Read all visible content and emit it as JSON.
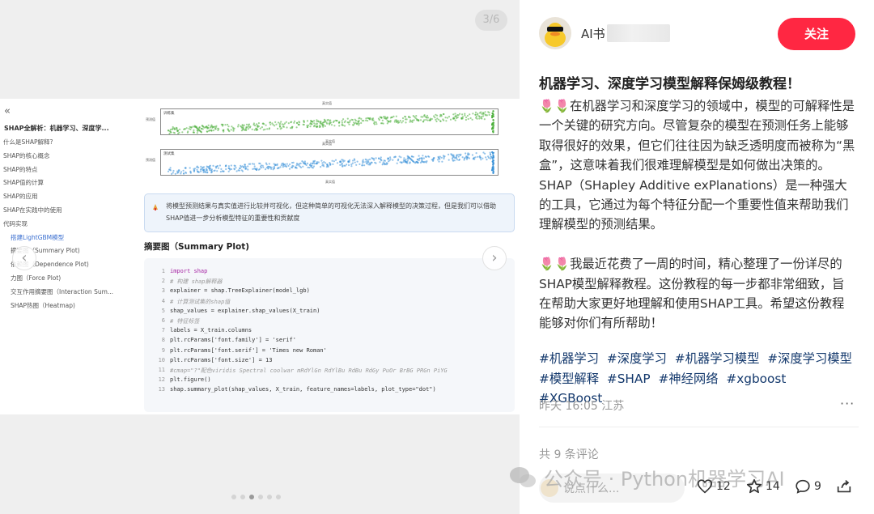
{
  "viewer": {
    "counter": "3/6",
    "prev_icon": "chevron-left-icon",
    "next_icon": "chevron-right-icon",
    "dots": [
      false,
      false,
      true,
      false,
      false,
      false
    ]
  },
  "doc": {
    "toc_collapse": "«",
    "toc_title": "SHAP全解析：机器学习、深度学...",
    "toc_items": [
      {
        "label": "什么是SHAP解释?",
        "sub": false,
        "active": false
      },
      {
        "label": "SHAP的核心概念",
        "sub": false,
        "active": false
      },
      {
        "label": "SHAP的特点",
        "sub": false,
        "active": false
      },
      {
        "label": "SHAP值的计算",
        "sub": false,
        "active": false
      },
      {
        "label": "SHAP的应用",
        "sub": false,
        "active": false
      },
      {
        "label": "SHAP在实践中的使用",
        "sub": false,
        "active": false
      },
      {
        "label": "代码实现",
        "sub": false,
        "active": false
      },
      {
        "label": "搭建LightGBM模型",
        "sub": true,
        "active": true
      },
      {
        "label": "摘要图（Summary Plot)",
        "sub": true,
        "active": false
      },
      {
        "label": "依赖图（Dependence Plot)",
        "sub": true,
        "active": false
      },
      {
        "label": "力图（Force Plot)",
        "sub": true,
        "active": false
      },
      {
        "label": "交互作用摘要图（Interaction Sum...",
        "sub": true,
        "active": false
      },
      {
        "label": "SHAP热图（Heatmap)",
        "sub": true,
        "active": false
      }
    ],
    "plots": [
      {
        "title": "真实值",
        "legend": "训练集",
        "xlabel": "真实值",
        "ylabel": "预测值",
        "color": "#4caf3c"
      },
      {
        "title": "真实值",
        "legend": "测试集",
        "xlabel": "真实值",
        "ylabel": "预测值",
        "color": "#3a92d8"
      }
    ],
    "note": "将模型预测结果与真实值进行比较并可视化，但这种简单的可视化无法深入解释模型的决策过程，但是我们可以借助SHAP值进一步分析模型特征的重要性和贡献度",
    "section_heading": "摘要图（Summary Plot)",
    "code": [
      {
        "n": "1",
        "t": "import shap",
        "c": "kw"
      },
      {
        "n": "2",
        "t": "# 构建 shap解释器",
        "c": "cm"
      },
      {
        "n": "3",
        "t": "explainer = shap.TreeExplainer(model_lgb)",
        "c": ""
      },
      {
        "n": "4",
        "t": "# 计算测试集的shap值",
        "c": "cm"
      },
      {
        "n": "5",
        "t": "shap_values = explainer.shap_values(X_train)",
        "c": ""
      },
      {
        "n": "6",
        "t": "# 特征标签",
        "c": "cm"
      },
      {
        "n": "7",
        "t": "labels = X_train.columns",
        "c": ""
      },
      {
        "n": "8",
        "t": "plt.rcParams['font.family'] = 'serif'",
        "c": ""
      },
      {
        "n": "9",
        "t": "plt.rcParams['font.serif'] = 'Times new Roman'",
        "c": ""
      },
      {
        "n": "10",
        "t": "plt.rcParams['font.size'] = 13",
        "c": ""
      },
      {
        "n": "11",
        "t": "#cmap=\"?\"配色viridis Spectral coolwar mRdYlGn RdYlBu RdBu RdGy PuOr BrBG PRGn PiYG",
        "c": "cm"
      },
      {
        "n": "12",
        "t": "plt.figure()",
        "c": ""
      },
      {
        "n": "13",
        "t": "shap.summary_plot(shap_values, X_train, feature_names=labels, plot_type=\"dot\")",
        "c": ""
      }
    ]
  },
  "post": {
    "author": "AI书",
    "follow_label": "关注",
    "title": "机器学习、深度学习模型解释保姆级教程！",
    "para1": "🌷🌷在机器学习和深度学习的领域中，模型的可解释性是一个关键的研究方向。尽管复杂的模型在预测任务上能够取得很好的效果，但它们往往因为缺乏透明度而被称为“黑盒”，这意味着我们很难理解模型是如何做出决策的。SHAP（SHapley Additive exPlanations）是一种强大的工具，它通过为每个特征分配一个重要性值来帮助我们理解模型的预测结果。",
    "para2": "🌷🌷我最近花费了一周的时间，精心整理了一份详尽的SHAP模型解释教程。这份教程的每一步都非常细致，旨在帮助大家更好地理解和使用SHAP工具。希望这份教程能够对你们有所帮助！",
    "tags": [
      "#机器学习",
      "#深度学习",
      "#机器学习模型",
      "#深度学习模型",
      "#模型解释",
      "#SHAP",
      "#神经网络",
      "#xgboost",
      "#XGBoost"
    ],
    "meta": "昨天 16:05 江苏",
    "more": "···",
    "comments_count": "共 9 条评论"
  },
  "footer": {
    "watermark": "公众号 · Python机器学习AI",
    "comment_placeholder": "说点什么...",
    "likes": "12",
    "stars": "14",
    "comments": "9"
  },
  "colors": {
    "accent": "#ff2742",
    "tag": "#13386c"
  }
}
